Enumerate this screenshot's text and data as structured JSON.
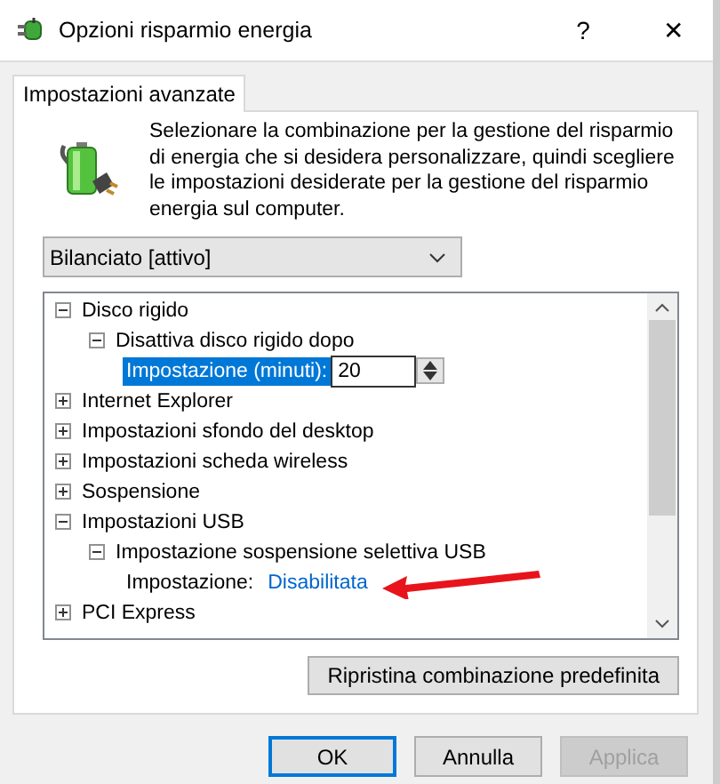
{
  "window": {
    "title": "Opzioni risparmio energia",
    "help": "?",
    "close": "✕"
  },
  "tabs": [
    {
      "label": "Impostazioni avanzate",
      "selected": true
    }
  ],
  "description": "Selezionare la combinazione per la gestione del risparmio di energia che si desidera personalizzare, quindi scegliere le impostazioni desiderate per la gestione del risparmio energia sul computer.",
  "plan_dropdown": {
    "value": "Bilanciato [attivo]"
  },
  "tree": [
    {
      "kind": "group",
      "label": "Disco rigido",
      "expanded": true,
      "children": [
        {
          "kind": "group",
          "label": "Disattiva disco rigido dopo",
          "expanded": true,
          "children": [
            {
              "kind": "spin",
              "label": "Impostazione (minuti):",
              "value": "20",
              "selected": true
            }
          ]
        }
      ]
    },
    {
      "kind": "group",
      "label": "Internet Explorer",
      "expanded": false
    },
    {
      "kind": "group",
      "label": "Impostazioni sfondo del desktop",
      "expanded": false
    },
    {
      "kind": "group",
      "label": "Impostazioni scheda wireless",
      "expanded": false
    },
    {
      "kind": "group",
      "label": "Sospensione",
      "expanded": false
    },
    {
      "kind": "group",
      "label": "Impostazioni USB",
      "expanded": true,
      "children": [
        {
          "kind": "group",
          "label": "Impostazione sospensione selettiva USB",
          "expanded": true,
          "children": [
            {
              "kind": "value",
              "label": "Impostazione:",
              "value": "Disabilitata",
              "selected": false,
              "annotated": true
            }
          ]
        }
      ]
    },
    {
      "kind": "group",
      "label": "PCI Express",
      "expanded": false
    }
  ],
  "restore_button": "Ripristina combinazione predefinita",
  "buttons": [
    {
      "label": "OK",
      "default": true,
      "disabled": false
    },
    {
      "label": "Annulla",
      "default": false,
      "disabled": false
    },
    {
      "label": "Applica",
      "default": false,
      "disabled": true
    }
  ]
}
